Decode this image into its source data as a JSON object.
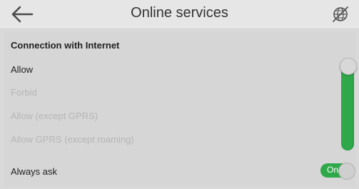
{
  "header": {
    "title": "Online services",
    "back_icon": "arrow-left-icon",
    "right_icon": "globe-off-icon"
  },
  "section": {
    "title": "Connection with Internet"
  },
  "options": [
    {
      "label": "Allow",
      "enabled": true
    },
    {
      "label": "Forbid",
      "enabled": false
    },
    {
      "label": "Allow (except GPRS)",
      "enabled": false
    },
    {
      "label": "Allow GPRS (except roaming)",
      "enabled": false
    }
  ],
  "selector": {
    "selected_index": 0,
    "accent": "#2fa84a"
  },
  "always_ask": {
    "label": "Always ask",
    "state": "On"
  }
}
